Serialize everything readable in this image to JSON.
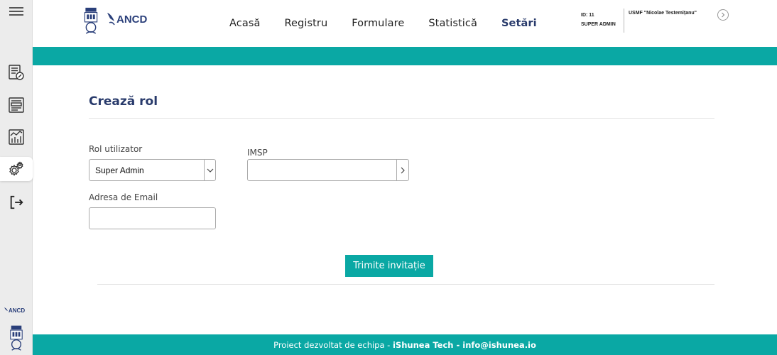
{
  "sidebar": {
    "items": [
      {
        "icon": "document-edit-icon"
      },
      {
        "icon": "register-list-icon"
      },
      {
        "icon": "statistics-chart-icon"
      },
      {
        "icon": "settings-gear-icon",
        "active": true
      },
      {
        "icon": "logout-icon"
      }
    ],
    "logo_text": "ANCD"
  },
  "header": {
    "logo_text": "ANCD",
    "nav": [
      "Acasă",
      "Registru",
      "Formulare",
      "Statistică",
      "Setări"
    ],
    "active_nav": "Setări",
    "user_id": "ID: 11",
    "user_role": "SUPER ADMIN",
    "organization": "USMF \"Nicolae Testemițanu\""
  },
  "form": {
    "title": "Crează rol",
    "role_label": "Rol utilizator",
    "role_value": "Super Admin",
    "imsp_label": "IMSP",
    "imsp_value": "",
    "email_label": "Adresa de Email",
    "email_value": "",
    "submit_label": "Trimite invitație"
  },
  "footer": {
    "prefix": "Proiect dezvoltat de echipa - ",
    "company": "iShunea Tech",
    "separator": " - ",
    "email": "info@ishunea.io"
  },
  "colors": {
    "accent": "#0aa8a4",
    "title": "#283a6b"
  }
}
